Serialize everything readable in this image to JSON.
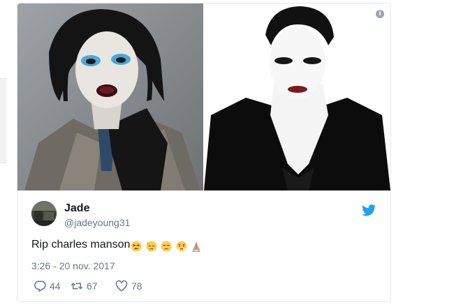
{
  "tweet": {
    "display_name": "Jade",
    "handle": "@jadeyoung31",
    "text": "Rip charles manson",
    "emojis": [
      "tired-face-emoji",
      "downcast-sweat-face-emoji",
      "unamused-face-emoji",
      "steam-nose-face-emoji",
      "folded-hands-emoji"
    ],
    "timestamp": "3:26 - 20 nov. 2017",
    "replies": "44",
    "retweets": "67",
    "likes": "78",
    "info_glyph": "i"
  },
  "icons": {
    "info": "info-circle-icon",
    "brand": "twitter-bird-icon",
    "reply": "reply-icon",
    "retweet": "retweet-icon",
    "like": "heart-icon"
  },
  "colors": {
    "brand": "#1da1f2",
    "text": "#14171a",
    "secondary": "#657786",
    "border": "#e1e8ed"
  }
}
